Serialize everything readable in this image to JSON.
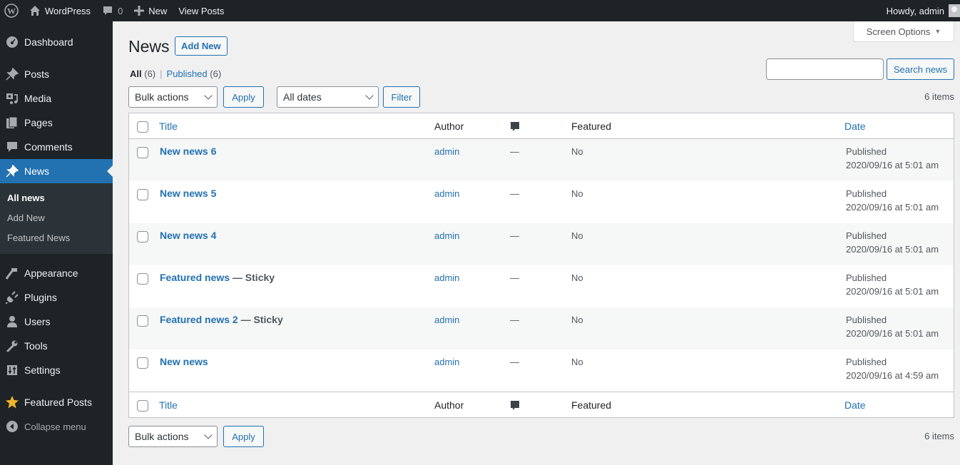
{
  "adminbar": {
    "wp_logo": "wordpress-logo-icon",
    "site_name": "WordPress",
    "comments_count": "0",
    "new_label": "New",
    "view_posts": "View Posts",
    "howdy": "Howdy, admin"
  },
  "sidebar": {
    "items": [
      {
        "label": "Dashboard",
        "icon": "dashboard-icon"
      },
      {
        "label": "Posts",
        "icon": "pin-icon"
      },
      {
        "label": "Media",
        "icon": "media-icon"
      },
      {
        "label": "Pages",
        "icon": "pages-icon"
      },
      {
        "label": "Comments",
        "icon": "comment-icon"
      },
      {
        "label": "News",
        "icon": "pin-icon",
        "active": true
      },
      {
        "label": "Appearance",
        "icon": "paintbrush-icon"
      },
      {
        "label": "Plugins",
        "icon": "plugin-icon"
      },
      {
        "label": "Users",
        "icon": "user-icon"
      },
      {
        "label": "Tools",
        "icon": "wrench-icon"
      },
      {
        "label": "Settings",
        "icon": "settings-icon"
      },
      {
        "label": "Featured Posts",
        "icon": "star-icon"
      }
    ],
    "submenu": [
      "All news",
      "Add New",
      "Featured News"
    ],
    "collapse": "Collapse menu"
  },
  "screen_options": "Screen Options",
  "page": {
    "title": "News",
    "add_new": "Add New"
  },
  "views": {
    "all_label": "All",
    "all_count": "(6)",
    "published_label": "Published",
    "published_count": "(6)"
  },
  "search": {
    "value": "",
    "placeholder": "",
    "button": "Search news"
  },
  "tablenav": {
    "bulk_actions": "Bulk actions",
    "apply": "Apply",
    "dates": "All dates",
    "filter": "Filter",
    "items_count": "6 items"
  },
  "table": {
    "columns": {
      "title": "Title",
      "author": "Author",
      "comments_icon": "comment-icon",
      "featured": "Featured",
      "date": "Date"
    },
    "rows": [
      {
        "title": "New news 6",
        "state": "",
        "author": "admin",
        "comments": "—",
        "featured": "No",
        "status": "Published",
        "date": "2020/09/16 at 5:01 am"
      },
      {
        "title": "New news 5",
        "state": "",
        "author": "admin",
        "comments": "—",
        "featured": "No",
        "status": "Published",
        "date": "2020/09/16 at 5:01 am"
      },
      {
        "title": "New news 4",
        "state": "",
        "author": "admin",
        "comments": "—",
        "featured": "No",
        "status": "Published",
        "date": "2020/09/16 at 5:01 am"
      },
      {
        "title": "Featured news",
        "state": " — Sticky",
        "author": "admin",
        "comments": "—",
        "featured": "No",
        "status": "Published",
        "date": "2020/09/16 at 5:01 am"
      },
      {
        "title": "Featured news 2",
        "state": " — Sticky",
        "author": "admin",
        "comments": "—",
        "featured": "No",
        "status": "Published",
        "date": "2020/09/16 at 5:01 am"
      },
      {
        "title": "New news",
        "state": "",
        "author": "admin",
        "comments": "—",
        "featured": "No",
        "status": "Published",
        "date": "2020/09/16 at 4:59 am"
      }
    ]
  },
  "colors": {
    "accent": "#2271b1",
    "adminbar_bg": "#1d2327",
    "submenu_bg": "#2c3338",
    "page_bg": "#f0f0f1"
  }
}
